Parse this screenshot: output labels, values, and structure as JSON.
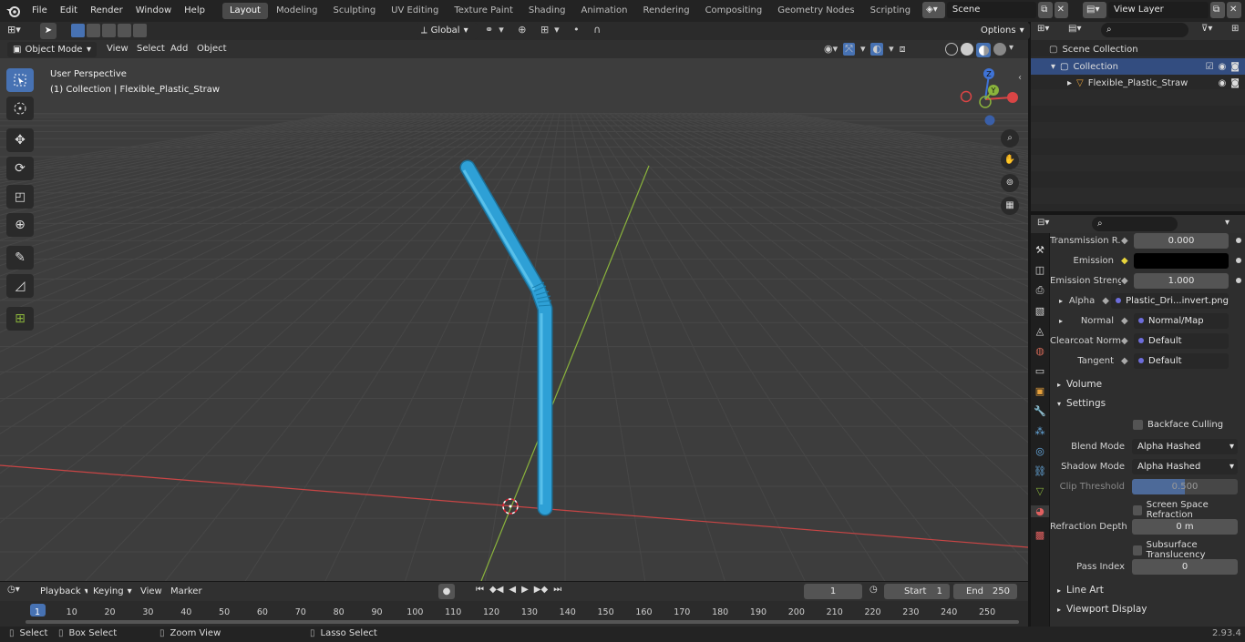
{
  "topbar": {
    "menus": [
      "File",
      "Edit",
      "Render",
      "Window",
      "Help"
    ],
    "workspaces": [
      "Layout",
      "Modeling",
      "Sculpting",
      "UV Editing",
      "Texture Paint",
      "Shading",
      "Animation",
      "Rendering",
      "Compositing",
      "Geometry Nodes",
      "Scripting"
    ],
    "active_workspace": "Layout",
    "scene": "Scene",
    "view_layer": "View Layer"
  },
  "viewport": {
    "mode": "Object Mode",
    "menus": [
      "View",
      "Select",
      "Add",
      "Object"
    ],
    "transform": "Global",
    "options": "Options",
    "overlay_title": "User Perspective",
    "overlay_sub": "(1) Collection | Flexible_Plastic_Straw",
    "gizmo": {
      "z": "Z",
      "y": "Y"
    }
  },
  "outliner": {
    "scene_collection": "Scene Collection",
    "collection": "Collection",
    "object": "Flexible_Plastic_Straw"
  },
  "properties": {
    "rows": [
      {
        "label": "Transmission R...",
        "value": "0.000",
        "type": "num"
      },
      {
        "label": "Emission",
        "value": "",
        "type": "color"
      },
      {
        "label": "Emission Strengt",
        "value": "1.000",
        "type": "num"
      },
      {
        "label": "Alpha",
        "value": "Plastic_Dri...invert.png",
        "type": "link"
      },
      {
        "label": "Normal",
        "value": "Normal/Map",
        "type": "link"
      },
      {
        "label": "Clearcoat Normal",
        "value": "Default",
        "type": "link"
      },
      {
        "label": "Tangent",
        "value": "Default",
        "type": "link"
      }
    ],
    "volume": "Volume",
    "settings": "Settings",
    "backface": "Backface Culling",
    "blend_label": "Blend Mode",
    "blend_value": "Alpha Hashed",
    "shadow_label": "Shadow Mode",
    "shadow_value": "Alpha Hashed",
    "clip_label": "Clip Threshold",
    "clip_value": "0.500",
    "ssr": "Screen Space Refraction",
    "refr_label": "Refraction Depth",
    "refr_value": "0 m",
    "sss": "Subsurface Translucency",
    "pass_label": "Pass Index",
    "pass_value": "0",
    "lineart": "Line Art",
    "viewport_display": "Viewport Display"
  },
  "timeline": {
    "menus": [
      "Playback",
      "Keying",
      "View",
      "Marker"
    ],
    "current": "1",
    "start_label": "Start",
    "start": "1",
    "end_label": "End",
    "end": "250",
    "ticks": [
      "1",
      "10",
      "20",
      "30",
      "40",
      "50",
      "60",
      "70",
      "80",
      "90",
      "100",
      "110",
      "120",
      "130",
      "140",
      "150",
      "160",
      "170",
      "180",
      "190",
      "200",
      "210",
      "220",
      "230",
      "240",
      "250"
    ]
  },
  "status": {
    "select": "Select",
    "box_select": "Box Select",
    "zoom_view": "Zoom View",
    "lasso_select": "Lasso Select",
    "version": "2.93.4"
  },
  "colors": {
    "accent": "#4772b3",
    "straw": "#2ea0d6",
    "x_axis": "#c94545",
    "y_axis": "#8ab33c"
  }
}
